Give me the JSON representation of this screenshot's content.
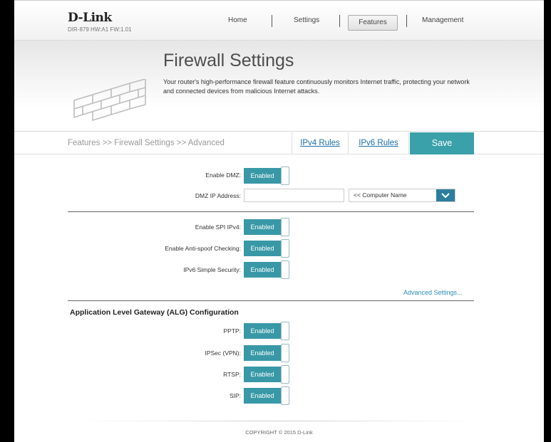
{
  "header": {
    "brand": "D-Link",
    "model": "DIR-879 HW:A1 FW:1.01",
    "nav": [
      "Home",
      "Settings",
      "Features",
      "Management"
    ],
    "active_nav": "Features"
  },
  "banner": {
    "title": "Firewall Settings",
    "description": "Your router's high-performance firewall feature continuously monitors Internet traffic, protecting your network and connected devices from malicious Internet attacks."
  },
  "subbar": {
    "breadcrumb": "Features >> Firewall Settings >> Advanced",
    "ipv4_rules": "IPv4 Rules",
    "ipv6_rules": "IPv6 Rules",
    "save": "Save"
  },
  "dmz": {
    "enable_label": "Enable DMZ:",
    "enable_value": "Enabled",
    "ip_label": "DMZ IP Address:",
    "ip_value": "",
    "computer_select": "<< Computer Name"
  },
  "security": {
    "spi_label": "Enable SPI IPv4:",
    "spi_value": "Enabled",
    "antispoof_label": "Enable Anti-spoof Checking:",
    "antispoof_value": "Enabled",
    "ipv6_label": "IPv6 Simple Security:",
    "ipv6_value": "Enabled",
    "advanced_link": "Advanced Settings..."
  },
  "alg": {
    "title": "Application Level Gateway (ALG) Configuration",
    "pptp_label": "PPTP:",
    "pptp_value": "Enabled",
    "ipsec_label": "IPSec (VPN):",
    "ipsec_value": "Enabled",
    "rtsp_label": "RTSP:",
    "rtsp_value": "Enabled",
    "sip_label": "SIP:",
    "sip_value": "Enabled"
  },
  "footer": {
    "copyright": "COPYRIGHT © 2015 D-Link"
  },
  "colors": {
    "accent": "#3aa0aa",
    "toggle_on": "#3898a6",
    "link": "#1e6fa8"
  }
}
